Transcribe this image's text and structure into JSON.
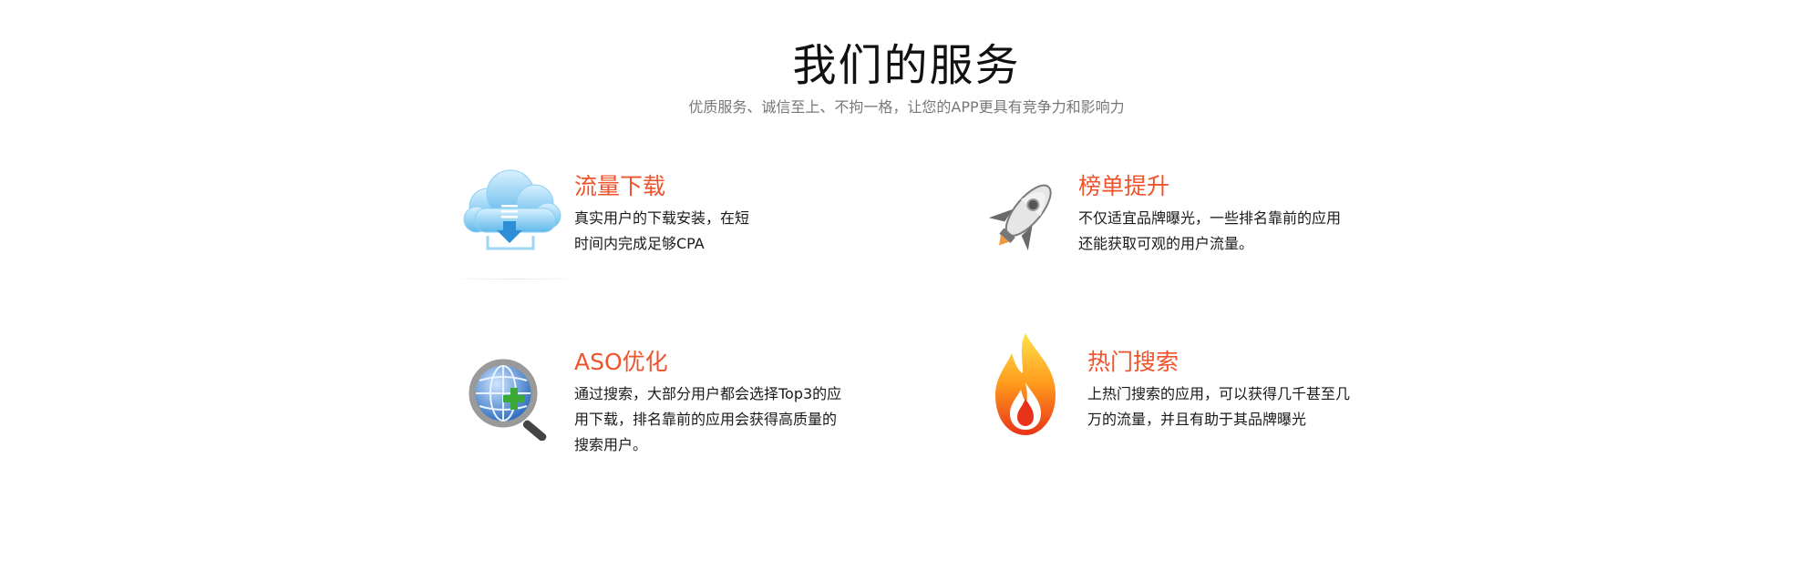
{
  "header": {
    "title": "我们的服务",
    "subtitle": "优质服务、诚信至上、不拘一格，让您的APP更具有竞争力和影响力"
  },
  "services": [
    {
      "icon": "cloud-download-icon",
      "title": "流量下载",
      "desc_lines": [
        "真实用户的下载安装，在短",
        "时间内完成足够CPA"
      ]
    },
    {
      "icon": "rocket-icon",
      "title": "榜单提升",
      "desc_lines": [
        "不仅适宜品牌曝光，一些排名靠前的应用",
        "还能获取可观的用户流量。"
      ]
    },
    {
      "icon": "globe-search-icon",
      "title": "ASO优化",
      "desc_lines": [
        "通过搜索，大部分用户都会选择Top3的应",
        "用下载，排名靠前的应用会获得高质量的",
        "搜索用户。"
      ]
    },
    {
      "icon": "fire-icon",
      "title": "热门搜索",
      "desc_lines": [
        "上热门搜索的应用，可以获得几千甚至几",
        "万的流量，并且有助于其品牌曝光"
      ]
    }
  ],
  "colors": {
    "accent": "#f0532b",
    "text": "#1a1a1a",
    "subtitle": "#777777"
  }
}
